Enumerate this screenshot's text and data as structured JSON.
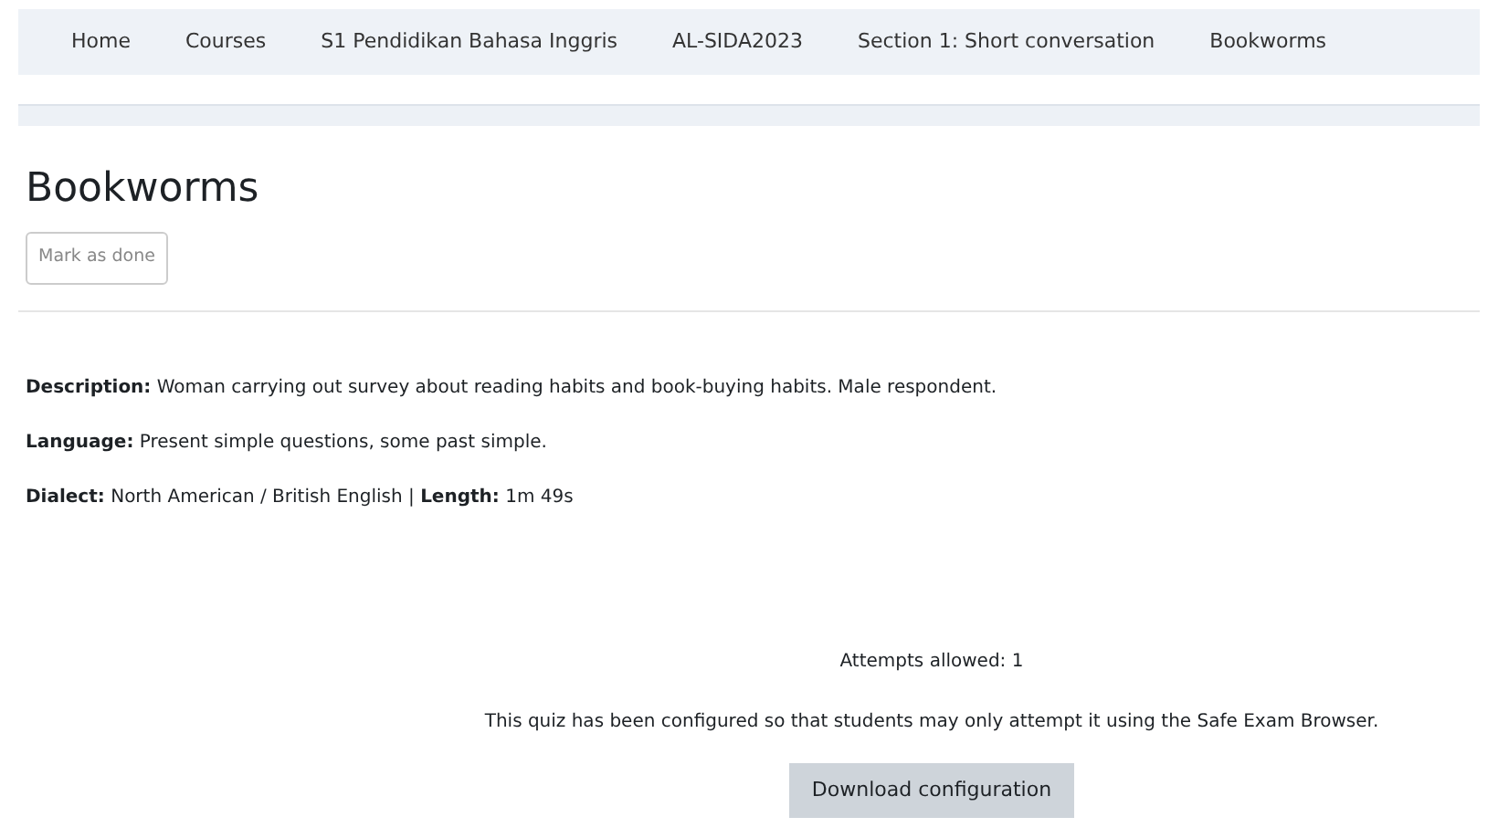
{
  "breadcrumb": [
    {
      "label": "Home"
    },
    {
      "label": "Courses"
    },
    {
      "label": "S1 Pendidikan Bahasa Inggris"
    },
    {
      "label": "AL-SIDA2023"
    },
    {
      "label": "Section 1: Short conversation"
    },
    {
      "label": "Bookworms"
    }
  ],
  "title": "Bookworms",
  "mark_button": "Mark as done",
  "details": [
    "**Description:** Woman carrying out survey about reading habits and book-buying habits. Male respondent.",
    "**Language:** Present simple questions, some past simple.",
    "**Dialect:** North American / British English | **Length:** 1m 49s"
  ],
  "attempts": "Attempts allowed: 1",
  "notice": "This quiz has been configured so that students may only attempt it using the Safe Exam Browser.",
  "download_button": "Download configuration"
}
